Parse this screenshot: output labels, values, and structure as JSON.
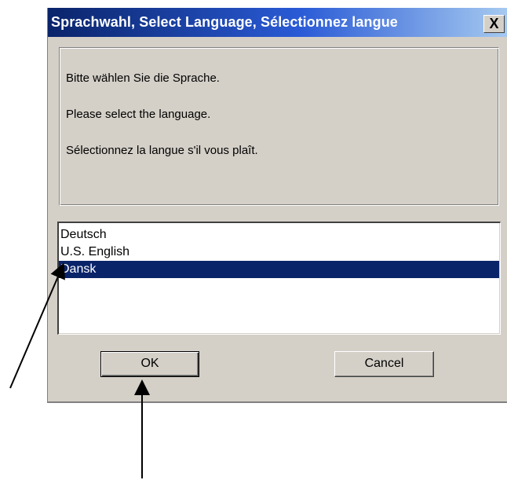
{
  "dialog": {
    "title": "Sprachwahl, Select Language, Sélectionnez langue",
    "close_glyph": "X",
    "messages": [
      "Bitte wählen Sie die Sprache.",
      "Please select the language.",
      "Sélectionnez la langue s'il vous plaît."
    ],
    "languages": [
      {
        "label": "Deutsch",
        "selected": false
      },
      {
        "label": "U.S. English",
        "selected": false
      },
      {
        "label": "Dansk",
        "selected": true
      }
    ],
    "buttons": {
      "ok_label": "OK",
      "cancel_label": "Cancel"
    }
  },
  "colors": {
    "dialog_bg": "#d4d0c8",
    "titlebar_start": "#0a246a",
    "titlebar_end": "#a6caf0",
    "selection": "#0a246a",
    "annotation_arrow": "#000000"
  }
}
